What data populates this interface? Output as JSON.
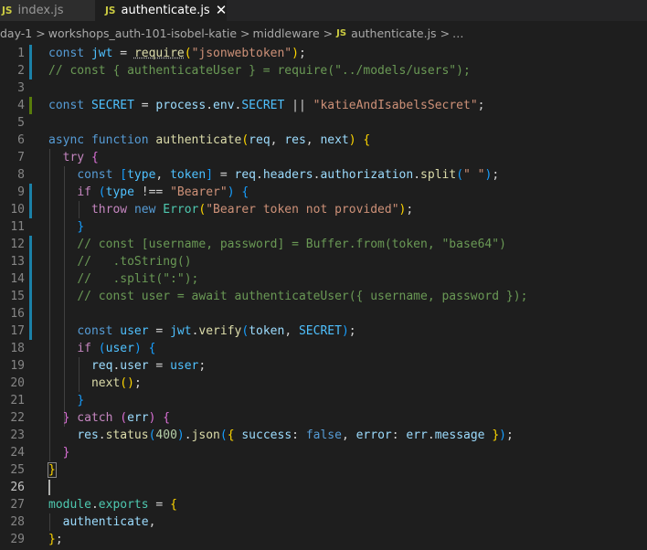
{
  "tabs": [
    {
      "icon": "JS",
      "label": "index.js"
    },
    {
      "icon": "JS",
      "label": "authenticate.js",
      "close": "✕"
    }
  ],
  "breadcrumb": {
    "items": [
      "day-1",
      "workshops_auth-101-isobel-katie",
      "middleware"
    ],
    "file_icon": "JS",
    "file": "authenticate.js",
    "ellipsis": "…",
    "separator": ">"
  },
  "editor": {
    "language": "javascript",
    "lines": [
      {
        "n": "1",
        "tokens": [
          [
            "kw",
            "const "
          ],
          [
            "const",
            "jwt"
          ],
          [
            "pl",
            " = "
          ],
          [
            "fn sq",
            "require"
          ],
          [
            "b1",
            "("
          ],
          [
            "str",
            "\"jsonwebtoken\""
          ],
          [
            "b1",
            ")"
          ],
          [
            "pl",
            ";"
          ]
        ]
      },
      {
        "n": "2",
        "tokens": [
          [
            "cmt",
            "// const { authenticateUser } = require(\"../models/users\");"
          ]
        ]
      },
      {
        "n": "3",
        "tokens": []
      },
      {
        "n": "4",
        "tokens": [
          [
            "kw",
            "const "
          ],
          [
            "const",
            "SECRET"
          ],
          [
            "pl",
            " = "
          ],
          [
            "var",
            "process"
          ],
          [
            "pl",
            "."
          ],
          [
            "var",
            "env"
          ],
          [
            "pl",
            "."
          ],
          [
            "const",
            "SECRET"
          ],
          [
            "pl",
            " || "
          ],
          [
            "str",
            "\"katieAndIsabelsSecret\""
          ],
          [
            "pl",
            ";"
          ]
        ]
      },
      {
        "n": "5",
        "tokens": []
      },
      {
        "n": "6",
        "tokens": [
          [
            "kw",
            "async "
          ],
          [
            "kw",
            "function "
          ],
          [
            "fn",
            "authenticate"
          ],
          [
            "b1",
            "("
          ],
          [
            "var",
            "req"
          ],
          [
            "pl",
            ", "
          ],
          [
            "var",
            "res"
          ],
          [
            "pl",
            ", "
          ],
          [
            "var",
            "next"
          ],
          [
            "b1",
            ")"
          ],
          [
            "pl",
            " "
          ],
          [
            "b1",
            "{"
          ]
        ]
      },
      {
        "n": "7",
        "tokens": [
          [
            "pl",
            "  "
          ],
          [
            "kw2",
            "try "
          ],
          [
            "b2",
            "{"
          ]
        ]
      },
      {
        "n": "8",
        "tokens": [
          [
            "pl",
            "    "
          ],
          [
            "kw",
            "const "
          ],
          [
            "b3",
            "["
          ],
          [
            "const",
            "type"
          ],
          [
            "pl",
            ", "
          ],
          [
            "const",
            "token"
          ],
          [
            "b3",
            "]"
          ],
          [
            "pl",
            " = "
          ],
          [
            "var",
            "req"
          ],
          [
            "pl",
            "."
          ],
          [
            "var",
            "headers"
          ],
          [
            "pl",
            "."
          ],
          [
            "var",
            "authorization"
          ],
          [
            "pl",
            "."
          ],
          [
            "fn",
            "split"
          ],
          [
            "b3",
            "("
          ],
          [
            "str",
            "\" \""
          ],
          [
            "b3",
            ")"
          ],
          [
            "pl",
            ";"
          ]
        ]
      },
      {
        "n": "9",
        "tokens": [
          [
            "pl",
            "    "
          ],
          [
            "kw2",
            "if "
          ],
          [
            "b3",
            "("
          ],
          [
            "const",
            "type"
          ],
          [
            "pl",
            " !== "
          ],
          [
            "str",
            "\"Bearer\""
          ],
          [
            "b3",
            ")"
          ],
          [
            "pl",
            " "
          ],
          [
            "b3",
            "{"
          ]
        ]
      },
      {
        "n": "10",
        "tokens": [
          [
            "pl",
            "      "
          ],
          [
            "kw2",
            "throw "
          ],
          [
            "kw",
            "new "
          ],
          [
            "cls",
            "Error"
          ],
          [
            "b1",
            "("
          ],
          [
            "str",
            "\"Bearer token not provided\""
          ],
          [
            "b1",
            ")"
          ],
          [
            "pl",
            ";"
          ]
        ]
      },
      {
        "n": "11",
        "tokens": [
          [
            "pl",
            "    "
          ],
          [
            "b3",
            "}"
          ]
        ]
      },
      {
        "n": "12",
        "tokens": [
          [
            "pl",
            "    "
          ],
          [
            "cmt",
            "// const [username, password] = Buffer.from(token, \"base64\")"
          ]
        ]
      },
      {
        "n": "13",
        "tokens": [
          [
            "pl",
            "    "
          ],
          [
            "cmt",
            "//   .toString()"
          ]
        ]
      },
      {
        "n": "14",
        "tokens": [
          [
            "pl",
            "    "
          ],
          [
            "cmt",
            "//   .split(\":\");"
          ]
        ]
      },
      {
        "n": "15",
        "tokens": [
          [
            "pl",
            "    "
          ],
          [
            "cmt",
            "// const user = await authenticateUser({ username, password });"
          ]
        ]
      },
      {
        "n": "16",
        "tokens": []
      },
      {
        "n": "17",
        "tokens": [
          [
            "pl",
            "    "
          ],
          [
            "kw",
            "const "
          ],
          [
            "const",
            "user"
          ],
          [
            "pl",
            " = "
          ],
          [
            "const",
            "jwt"
          ],
          [
            "pl",
            "."
          ],
          [
            "fn",
            "verify"
          ],
          [
            "b3",
            "("
          ],
          [
            "var",
            "token"
          ],
          [
            "pl",
            ", "
          ],
          [
            "const",
            "SECRET"
          ],
          [
            "b3",
            ")"
          ],
          [
            "pl",
            ";"
          ]
        ]
      },
      {
        "n": "18",
        "tokens": [
          [
            "pl",
            "    "
          ],
          [
            "kw2",
            "if "
          ],
          [
            "b3",
            "("
          ],
          [
            "const",
            "user"
          ],
          [
            "b3",
            ")"
          ],
          [
            "pl",
            " "
          ],
          [
            "b3",
            "{"
          ]
        ]
      },
      {
        "n": "19",
        "tokens": [
          [
            "pl",
            "      "
          ],
          [
            "var",
            "req"
          ],
          [
            "pl",
            "."
          ],
          [
            "var",
            "user"
          ],
          [
            "pl",
            " = "
          ],
          [
            "const",
            "user"
          ],
          [
            "pl",
            ";"
          ]
        ]
      },
      {
        "n": "20",
        "tokens": [
          [
            "pl",
            "      "
          ],
          [
            "fn",
            "next"
          ],
          [
            "b1",
            "("
          ],
          [
            "b1",
            ")"
          ],
          [
            "pl",
            ";"
          ]
        ]
      },
      {
        "n": "21",
        "tokens": [
          [
            "pl",
            "    "
          ],
          [
            "b3",
            "}"
          ]
        ]
      },
      {
        "n": "22",
        "tokens": [
          [
            "pl",
            "  "
          ],
          [
            "b2",
            "}"
          ],
          [
            "kw2",
            " catch "
          ],
          [
            "b2",
            "("
          ],
          [
            "var",
            "err"
          ],
          [
            "b2",
            ")"
          ],
          [
            "pl",
            " "
          ],
          [
            "b2",
            "{"
          ]
        ]
      },
      {
        "n": "23",
        "tokens": [
          [
            "pl",
            "    "
          ],
          [
            "var",
            "res"
          ],
          [
            "pl",
            "."
          ],
          [
            "fn",
            "status"
          ],
          [
            "b3",
            "("
          ],
          [
            "num",
            "400"
          ],
          [
            "b3",
            ")"
          ],
          [
            "pl",
            "."
          ],
          [
            "fn",
            "json"
          ],
          [
            "b3",
            "("
          ],
          [
            "b1",
            "{"
          ],
          [
            "var",
            " success"
          ],
          [
            "pl",
            ": "
          ],
          [
            "kw",
            "false"
          ],
          [
            "pl",
            ", "
          ],
          [
            "var",
            "error"
          ],
          [
            "pl",
            ": "
          ],
          [
            "var",
            "err"
          ],
          [
            "pl",
            "."
          ],
          [
            "var",
            "message"
          ],
          [
            "pl",
            " "
          ],
          [
            "b1",
            "}"
          ],
          [
            "b3",
            ")"
          ],
          [
            "pl",
            ";"
          ]
        ]
      },
      {
        "n": "24",
        "tokens": [
          [
            "pl",
            "  "
          ],
          [
            "b2",
            "}"
          ]
        ]
      },
      {
        "n": "25",
        "tokens": [
          [
            "b1 bracket-box",
            "}"
          ]
        ]
      },
      {
        "n": "26",
        "tokens": []
      },
      {
        "n": "27",
        "tokens": [
          [
            "cls",
            "module"
          ],
          [
            "pl",
            "."
          ],
          [
            "cls",
            "exports"
          ],
          [
            "pl",
            " = "
          ],
          [
            "b1",
            "{"
          ]
        ]
      },
      {
        "n": "28",
        "tokens": [
          [
            "pl",
            "  "
          ],
          [
            "var",
            "authenticate"
          ],
          [
            "pl",
            ","
          ]
        ]
      },
      {
        "n": "29",
        "tokens": [
          [
            "b1",
            "}"
          ],
          [
            "pl",
            ";"
          ]
        ]
      }
    ]
  }
}
